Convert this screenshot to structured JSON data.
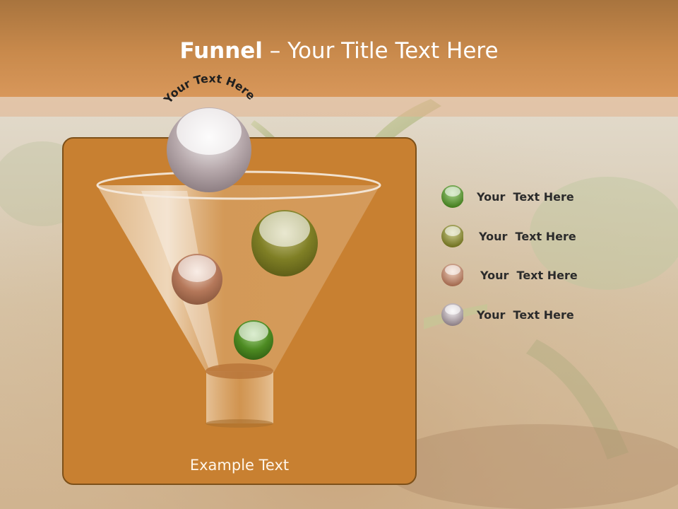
{
  "slide": {
    "title_bold": "Funnel",
    "title_rest": " – Your Title Text Here",
    "arc_text": "Your Text Here",
    "example_text": "Example Text"
  },
  "legend": [
    {
      "label": "Your  Text Here",
      "color": "#4f8a2a",
      "icon": "green-sphere"
    },
    {
      "label": "Your  Text Here",
      "color": "#7d8024",
      "icon": "olive-sphere"
    },
    {
      "label": "Your  Text Here",
      "color": "#b37755",
      "icon": "bronze-sphere"
    },
    {
      "label": "Your  Text Here",
      "color": "#9a8c94",
      "icon": "silver-sphere"
    }
  ],
  "colors": {
    "header": "#c98a4c",
    "panel": "#c88031",
    "panel_border": "#7d5019"
  }
}
